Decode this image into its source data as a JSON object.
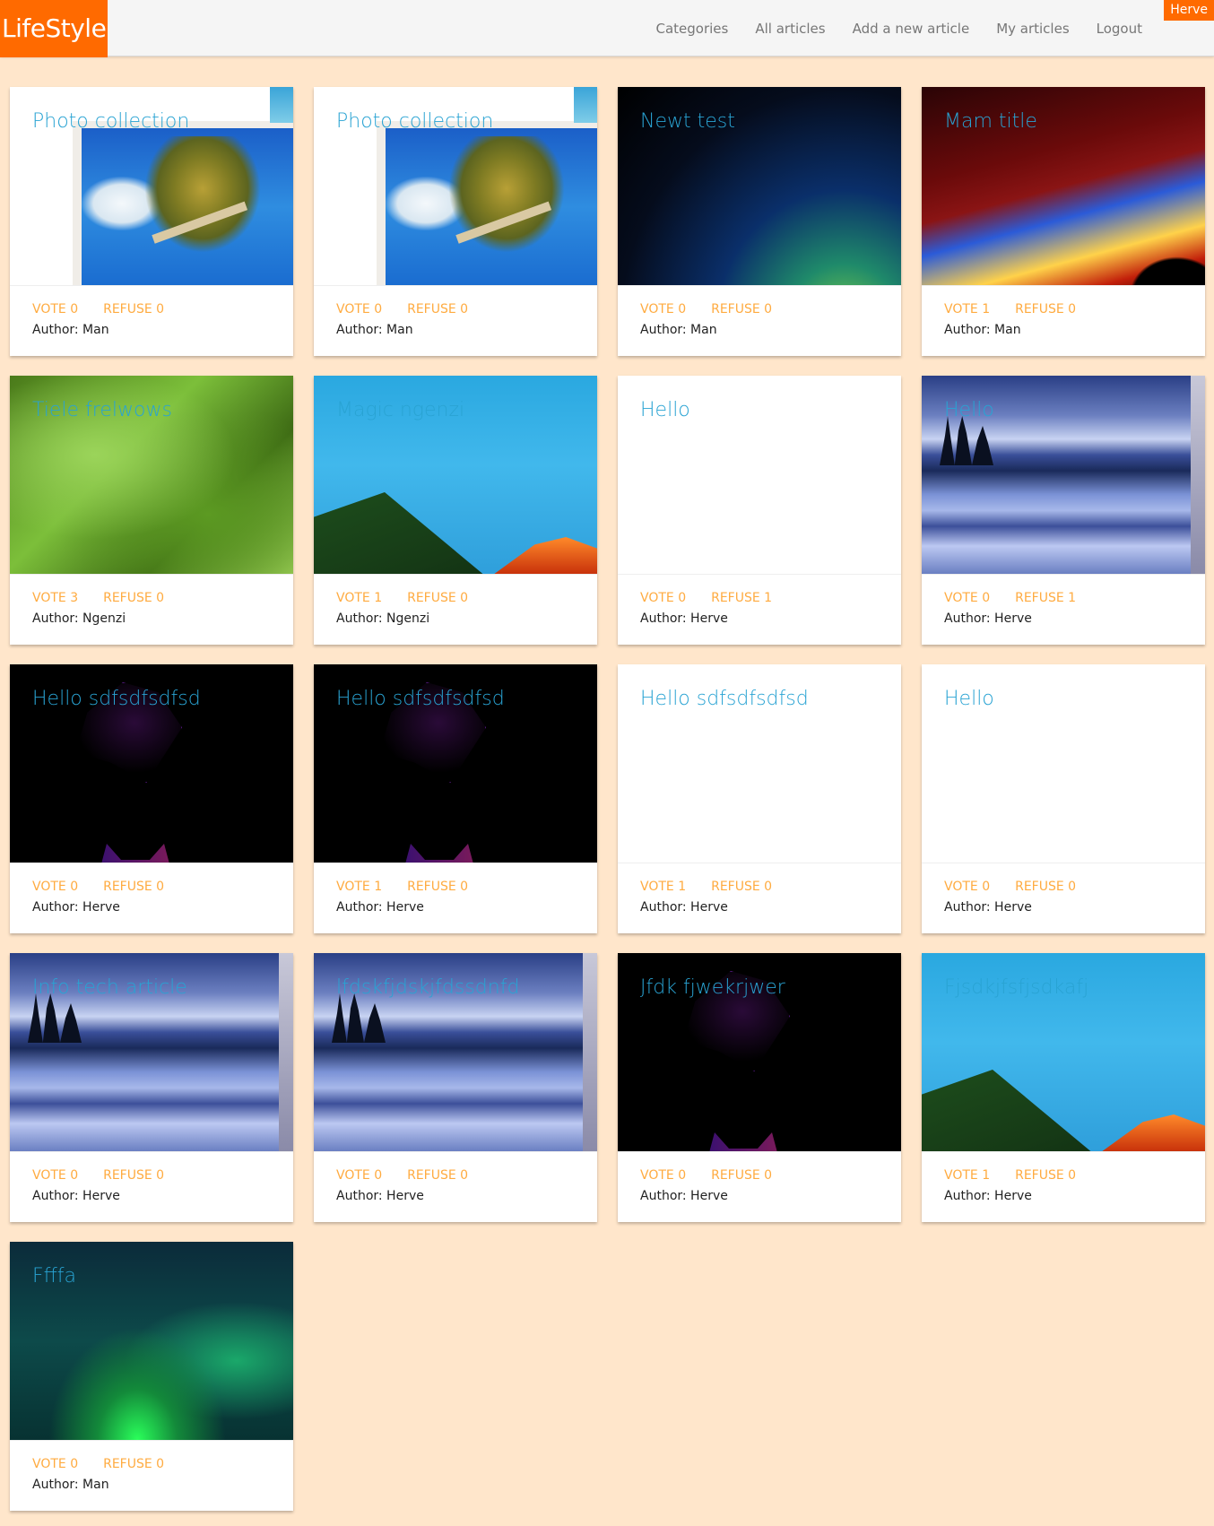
{
  "navbar": {
    "brand": "LifeStyle",
    "links": [
      "Categories",
      "All articles",
      "Add a new article",
      "My articles",
      "Logout"
    ],
    "user": "Herve",
    "colors": {
      "brand": "#ff6a00",
      "link": "#777777"
    }
  },
  "articles": [
    {
      "title": "Photo collection",
      "vote": "VOTE 0",
      "refuse": "REFUSE 0",
      "author": "Author: Man",
      "image": "beach"
    },
    {
      "title": "Photo collection",
      "vote": "VOTE 0",
      "refuse": "REFUSE 0",
      "author": "Author: Man",
      "image": "beach"
    },
    {
      "title": "Newt test",
      "vote": "VOTE 0",
      "refuse": "REFUSE 0",
      "author": "Author: Man",
      "image": "space"
    },
    {
      "title": "Mam title",
      "vote": "VOTE 1",
      "refuse": "REFUSE 0",
      "author": "Author: Man",
      "image": "cosmic"
    },
    {
      "title": "Tiele frelwows",
      "vote": "VOTE 3",
      "refuse": "REFUSE 0",
      "author": "Author: Ngenzi",
      "image": "forest"
    },
    {
      "title": "Magic ngenzi",
      "vote": "VOTE 1",
      "refuse": "REFUSE 0",
      "author": "Author: Ngenzi",
      "image": "mountain"
    },
    {
      "title": "Hello",
      "vote": "VOTE 0",
      "refuse": "REFUSE 1",
      "author": "Author: Herve",
      "image": "white"
    },
    {
      "title": "Hello",
      "vote": "VOTE 0",
      "refuse": "REFUSE 1",
      "author": "Author: Herve",
      "image": "lake"
    },
    {
      "title": "Hello sdfsdfsdfsd",
      "vote": "VOTE 0",
      "refuse": "REFUSE 0",
      "author": "Author: Herve",
      "image": "black"
    },
    {
      "title": "Hello sdfsdfsdfsd",
      "vote": "VOTE 1",
      "refuse": "REFUSE 0",
      "author": "Author: Herve",
      "image": "black"
    },
    {
      "title": "Hello sdfsdfsdfsd",
      "vote": "VOTE 1",
      "refuse": "REFUSE 0",
      "author": "Author: Herve",
      "image": "white"
    },
    {
      "title": "Hello",
      "vote": "VOTE 0",
      "refuse": "REFUSE 0",
      "author": "Author: Herve",
      "image": "white"
    },
    {
      "title": "Info tech article",
      "vote": "VOTE 0",
      "refuse": "REFUSE 0",
      "author": "Author: Herve",
      "image": "lake"
    },
    {
      "title": "lfdskfjdskjfdssdnfd",
      "vote": "VOTE 0",
      "refuse": "REFUSE 0",
      "author": "Author: Herve",
      "image": "lake"
    },
    {
      "title": "Jfdk fjwekrjwer",
      "vote": "VOTE 0",
      "refuse": "REFUSE 0",
      "author": "Author: Herve",
      "image": "black"
    },
    {
      "title": "Fjsdkjfsfjsdkafj",
      "vote": "VOTE 1",
      "refuse": "REFUSE 0",
      "author": "Author: Herve",
      "image": "mountain"
    },
    {
      "title": "Ffffa",
      "vote": "VOTE 0",
      "refuse": "REFUSE 0",
      "author": "Author: Man",
      "image": "aurora"
    }
  ],
  "colors": {
    "page_bg": "#ffe6cb",
    "title": "#29a3d3",
    "action": "#ffab40"
  }
}
